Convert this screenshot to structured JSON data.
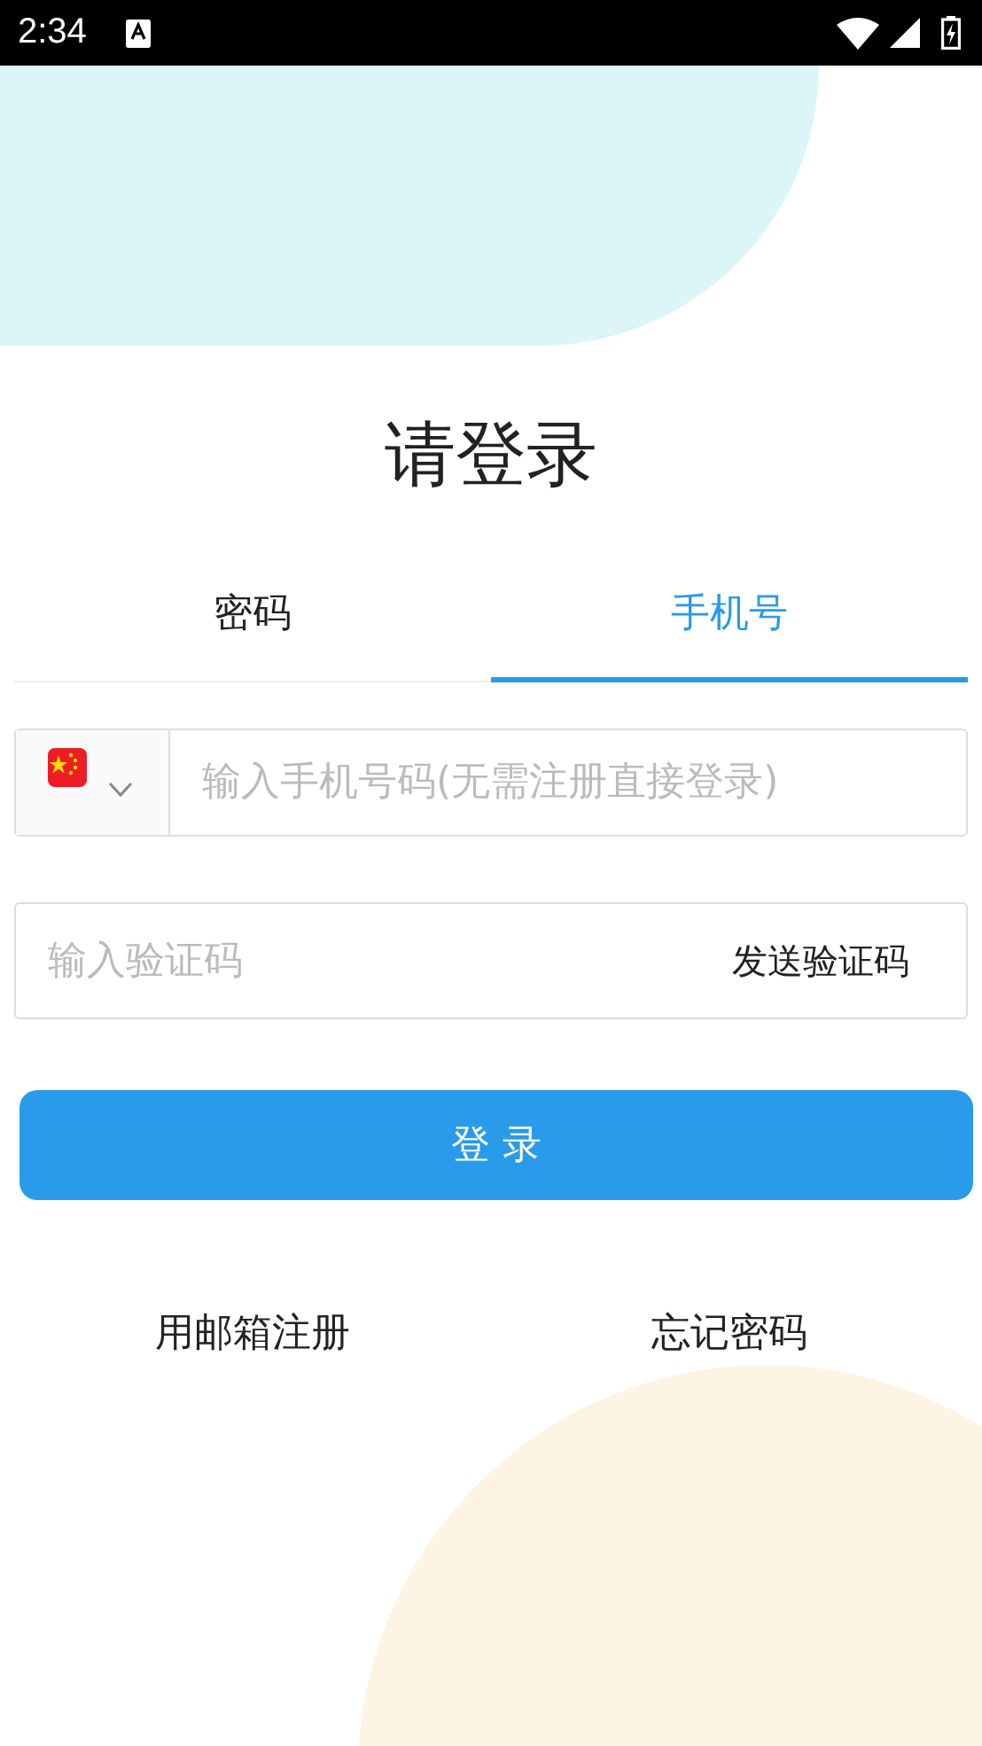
{
  "status_bar": {
    "time": "2:34"
  },
  "title": "请登录",
  "tabs": [
    {
      "label": "密码",
      "selected": false
    },
    {
      "label": "手机号",
      "selected": true
    }
  ],
  "phone_field": {
    "placeholder": "输入手机号码(无需注册直接登录)"
  },
  "code_field": {
    "placeholder": "输入验证码",
    "action": "发送验证码"
  },
  "login_button": "登 录",
  "links": [
    "用邮箱注册",
    "忘记密码"
  ]
}
